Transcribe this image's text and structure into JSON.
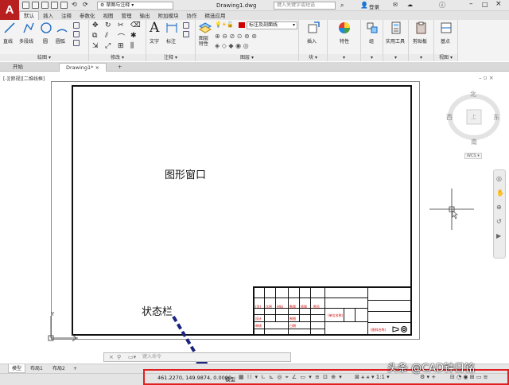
{
  "title_bar": {
    "app_letter": "A",
    "workspace": "草图与注释",
    "doc_title": "Drawing1.dwg",
    "search_placeholder": "键入关键字或短语",
    "login": "登录"
  },
  "ribbon_tabs": [
    "默认",
    "插入",
    "注释",
    "参数化",
    "视图",
    "管理",
    "输出",
    "附加模块",
    "协作",
    "精选应用"
  ],
  "ribbon": {
    "draw": {
      "line": "直线",
      "polyline": "多段线",
      "circle": "圆",
      "arc": "圆弧",
      "panel": "绘图"
    },
    "modify": {
      "panel": "修改"
    },
    "annotation": {
      "text": "文字",
      "dimension": "标注",
      "panel": "注释"
    },
    "layers": {
      "layer_props": "图层特性",
      "current_layer": "标注及剖面线",
      "panel": "图层"
    },
    "block": {
      "insert": "插入",
      "panel": "块"
    },
    "properties": {
      "label": "特性"
    },
    "groups": {
      "label": "组"
    },
    "utilities": {
      "label": "实用工具"
    },
    "clipboard": {
      "label": "剪贴板"
    },
    "base": {
      "label": "基点",
      "panel": "视图"
    }
  },
  "file_tabs": {
    "start": "开始",
    "drawing": "Drawing1*",
    "add": "+"
  },
  "viewport": {
    "label": "[-][俯视][二维线框]",
    "compass": {
      "north": "北",
      "south": "南",
      "east": "东",
      "west": "西",
      "top": "上",
      "wcs": "WCS"
    },
    "annotations": {
      "graphics_window": "图形窗口",
      "status_bar": "状态栏"
    },
    "axis_y": "Y",
    "titleblock_red": [
      "(学)",
      "比例",
      "材料",
      "数量",
      "质量",
      "图号",
      "设计",
      "审核",
      "制图",
      "日期",
      "(单位名称)",
      "(图样名称)"
    ]
  },
  "command_line": {
    "placeholder": "键入命令"
  },
  "layout_tabs": {
    "model": "模型",
    "layout1": "布局1",
    "layout2": "布局2",
    "add": "+"
  },
  "status_bar": {
    "coords": "461.2270, 149.9874, 0.0000",
    "mode": "模型",
    "scale": "1:1"
  },
  "watermark": "头条 @CAD钟日铭",
  "colors": {
    "app_red": "#b81f1f",
    "status_highlight": "#e02020",
    "arrow_navy": "#1a237e"
  }
}
